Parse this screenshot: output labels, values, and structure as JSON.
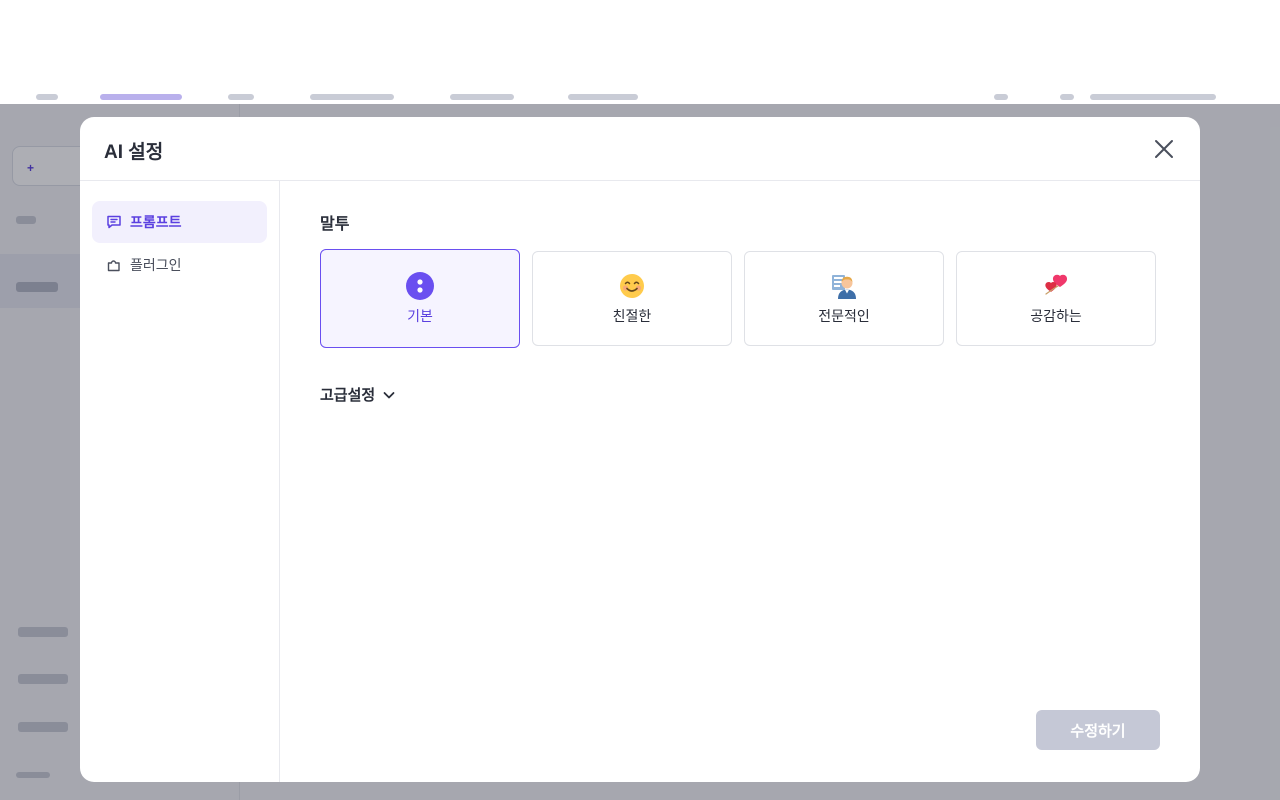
{
  "modal": {
    "title": "AI 설정",
    "close_icon": "close-icon"
  },
  "sidebar": {
    "items": [
      {
        "label": "프롬프트",
        "icon": "chat-message-icon",
        "active": true
      },
      {
        "label": "플러그인",
        "icon": "plugin-icon",
        "active": false
      }
    ]
  },
  "tone": {
    "section_label": "말투",
    "options": [
      {
        "label": "기본",
        "icon": "default-tone-icon",
        "selected": true
      },
      {
        "label": "친절한",
        "icon": "smiling-face-icon",
        "selected": false
      },
      {
        "label": "전문적인",
        "icon": "professional-person-icon",
        "selected": false
      },
      {
        "label": "공감하는",
        "icon": "heart-icon",
        "selected": false
      }
    ]
  },
  "advanced": {
    "label": "고급설정",
    "icon": "chevron-down-icon"
  },
  "actions": {
    "submit_label": "수정하기"
  },
  "colors": {
    "accent": "#6a4ff0",
    "submit_disabled": "#c5c8d6",
    "overlay": "rgba(20,24,40,0.35)"
  }
}
